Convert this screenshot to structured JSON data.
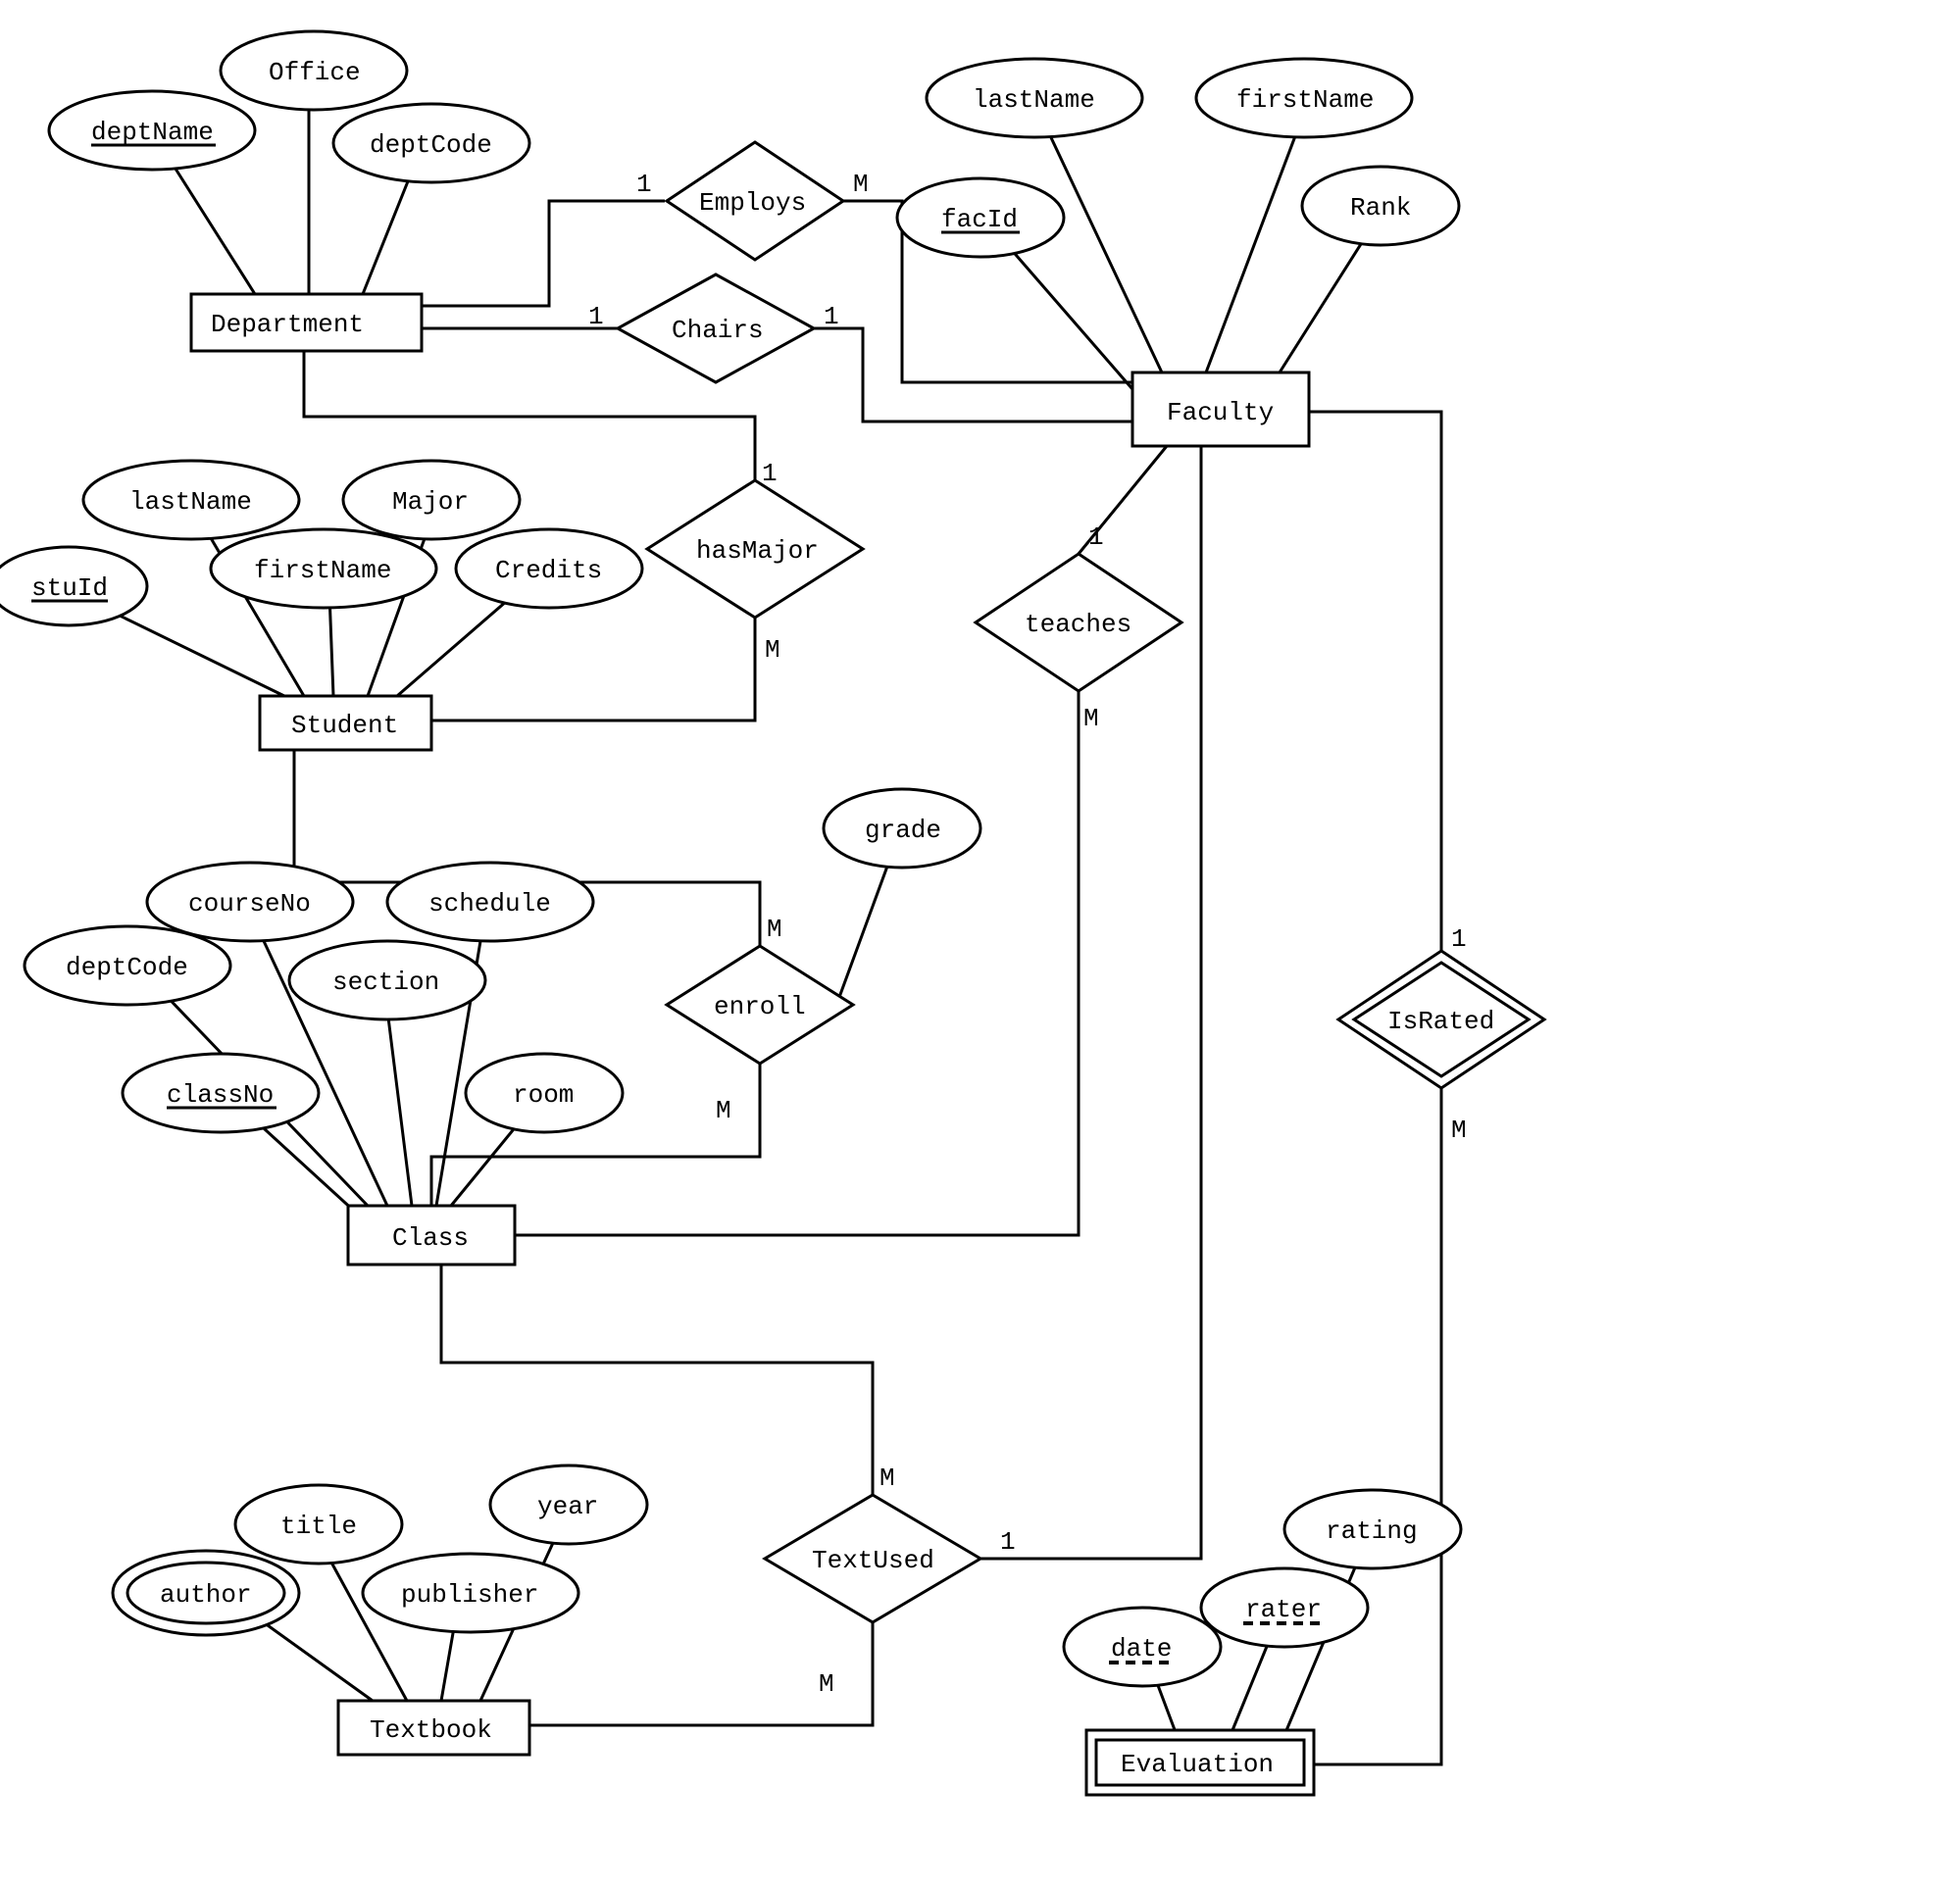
{
  "entities": {
    "department": {
      "label": "Department",
      "attrs": {
        "deptName": "deptName",
        "office": "Office",
        "deptCode": "deptCode"
      }
    },
    "faculty": {
      "label": "Faculty",
      "attrs": {
        "lastName": "lastName",
        "firstName": "firstName",
        "facId": "facId",
        "rank": "Rank"
      }
    },
    "student": {
      "label": "Student",
      "attrs": {
        "stuId": "stuId",
        "lastName": "lastName",
        "firstName": "firstName",
        "major": "Major",
        "credits": "Credits"
      }
    },
    "class": {
      "label": "Class",
      "attrs": {
        "deptCode": "deptCode",
        "courseNo": "courseNo",
        "section": "section",
        "schedule": "schedule",
        "classNo": "classNo",
        "room": "room"
      }
    },
    "textbook": {
      "label": "Textbook",
      "attrs": {
        "author": "author",
        "title": "title",
        "publisher": "publisher",
        "year": "year"
      }
    },
    "evaluation": {
      "label": "Evaluation",
      "attrs": {
        "date": "date",
        "rater": "rater",
        "rating": "rating"
      }
    }
  },
  "relationships": {
    "employs": {
      "label": "Employs",
      "card": {
        "dept": "1",
        "fac": "M"
      }
    },
    "chairs": {
      "label": "Chairs",
      "card": {
        "dept": "1",
        "fac": "1"
      }
    },
    "hasMajor": {
      "label": "hasMajor",
      "card": {
        "dept": "1",
        "stu": "M"
      }
    },
    "teaches": {
      "label": "teaches",
      "card": {
        "fac": "1",
        "cls": "M"
      }
    },
    "enroll": {
      "label": "enroll",
      "attr": "grade",
      "card": {
        "stu": "M",
        "cls": "M"
      }
    },
    "textUsed": {
      "label": "TextUsed",
      "card": {
        "cls": "M",
        "txt": "M",
        "fac": "1"
      }
    },
    "isRated": {
      "label": "IsRated",
      "card": {
        "fac": "1",
        "eval": "M"
      }
    }
  }
}
